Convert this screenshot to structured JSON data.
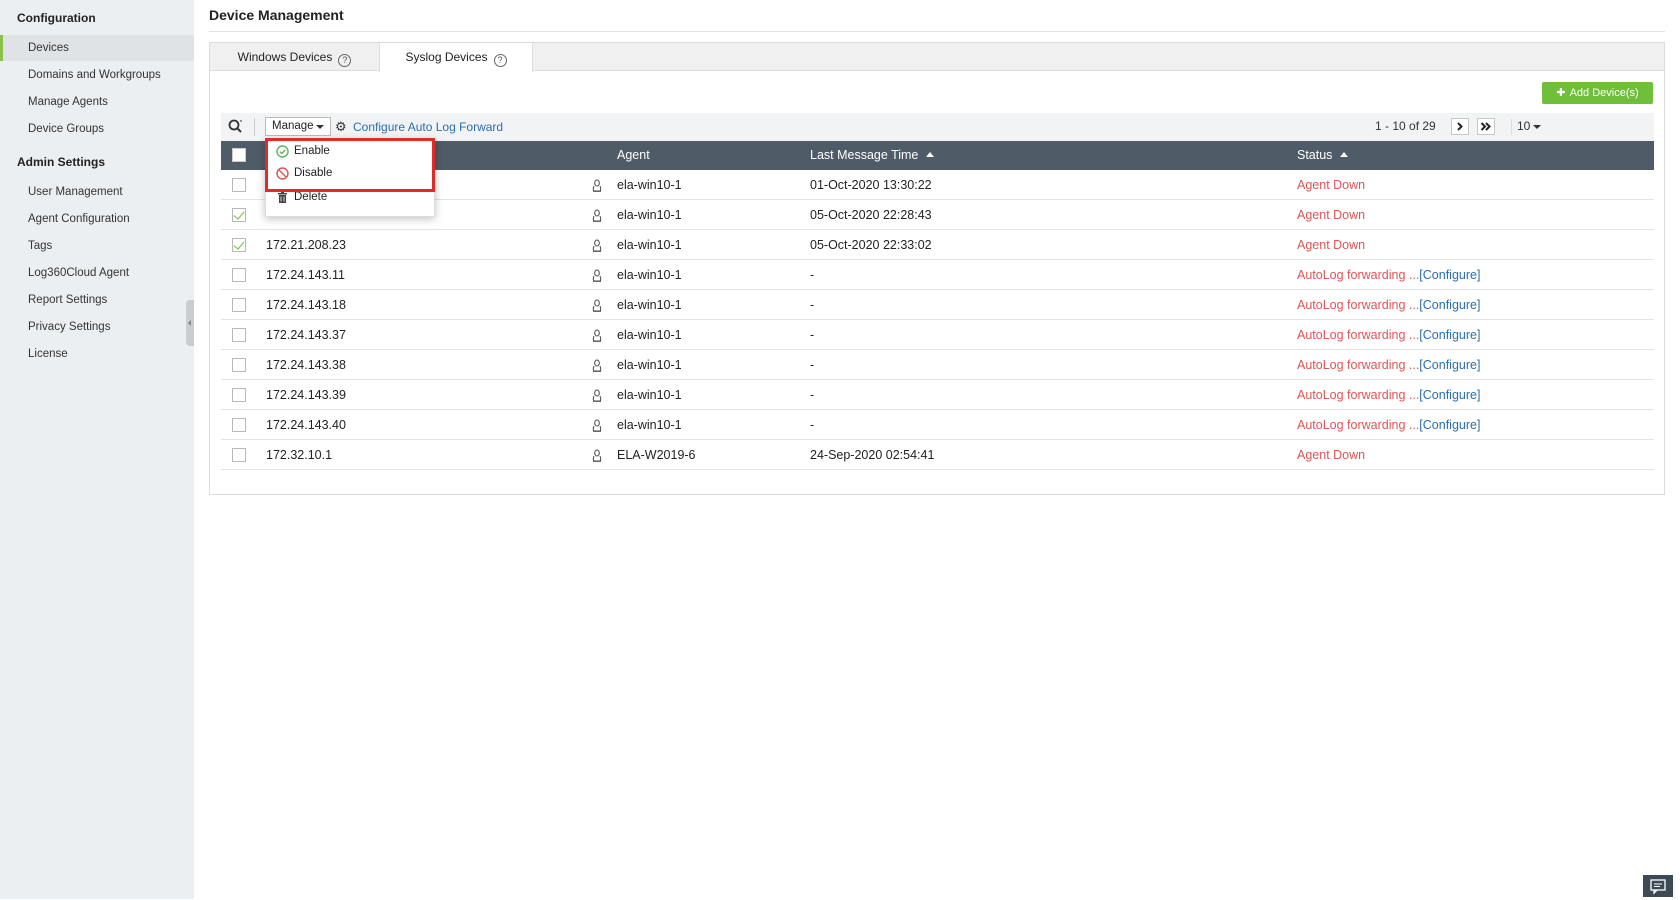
{
  "sidebar": {
    "sections": [
      {
        "title": "Configuration",
        "items": [
          "Devices",
          "Domains and Workgroups",
          "Manage Agents",
          "Device Groups"
        ]
      },
      {
        "title": "Admin Settings",
        "items": [
          "User Management",
          "Agent Configuration",
          "Tags",
          "Log360Cloud Agent",
          "Report Settings",
          "Privacy Settings",
          "License"
        ]
      }
    ],
    "active_item": "Devices"
  },
  "page": {
    "title": "Device Management"
  },
  "tabs": [
    {
      "label": "Windows Devices",
      "help": "?"
    },
    {
      "label": "Syslog Devices",
      "help": "?"
    }
  ],
  "active_tab": "Syslog Devices",
  "actions": {
    "add_device": "Add Device(s)"
  },
  "toolbar": {
    "manage_label": "Manage",
    "configure_link": "Configure Auto Log Forward",
    "pager_range": "1 - 10 of 29",
    "per_page": "10"
  },
  "manage_menu": [
    {
      "label": "Enable",
      "icon": "check-circle-icon"
    },
    {
      "label": "Disable",
      "icon": "disable-circle-icon"
    },
    {
      "label": "Delete",
      "icon": "trash-icon"
    }
  ],
  "table": {
    "columns": [
      "Agent",
      "Last Message Time",
      "Status"
    ],
    "rows": [
      {
        "device": "",
        "agent": "ela-win10-1",
        "time": "01-Oct-2020 13:30:22",
        "status": "Agent Down",
        "configure": "",
        "checked": false
      },
      {
        "device": "",
        "agent": "ela-win10-1",
        "time": "05-Oct-2020 22:28:43",
        "status": "Agent Down",
        "configure": "",
        "checked": true
      },
      {
        "device": "172.21.208.23",
        "agent": "ela-win10-1",
        "time": "05-Oct-2020 22:33:02",
        "status": "Agent Down",
        "configure": "",
        "checked": true
      },
      {
        "device": "172.24.143.11",
        "agent": "ela-win10-1",
        "time": "-",
        "status": "AutoLog forwarding ...",
        "configure": "[Configure]",
        "checked": false
      },
      {
        "device": "172.24.143.18",
        "agent": "ela-win10-1",
        "time": "-",
        "status": "AutoLog forwarding ...",
        "configure": "[Configure]",
        "checked": false
      },
      {
        "device": "172.24.143.37",
        "agent": "ela-win10-1",
        "time": "-",
        "status": "AutoLog forwarding ...",
        "configure": "[Configure]",
        "checked": false
      },
      {
        "device": "172.24.143.38",
        "agent": "ela-win10-1",
        "time": "-",
        "status": "AutoLog forwarding ...",
        "configure": "[Configure]",
        "checked": false
      },
      {
        "device": "172.24.143.39",
        "agent": "ela-win10-1",
        "time": "-",
        "status": "AutoLog forwarding ...",
        "configure": "[Configure]",
        "checked": false
      },
      {
        "device": "172.24.143.40",
        "agent": "ela-win10-1",
        "time": "-",
        "status": "AutoLog forwarding ...",
        "configure": "[Configure]",
        "checked": false
      },
      {
        "device": "172.32.10.1",
        "agent": "ELA-W2019-6",
        "time": "24-Sep-2020 02:54:41",
        "status": "Agent Down",
        "configure": "",
        "checked": false
      }
    ]
  },
  "colors": {
    "accent_green": "#6fbf3a",
    "header_bg": "#4f5b66",
    "status_red": "#e05555",
    "link_blue": "#2a6fb0",
    "highlight_red": "#e02b2b"
  }
}
